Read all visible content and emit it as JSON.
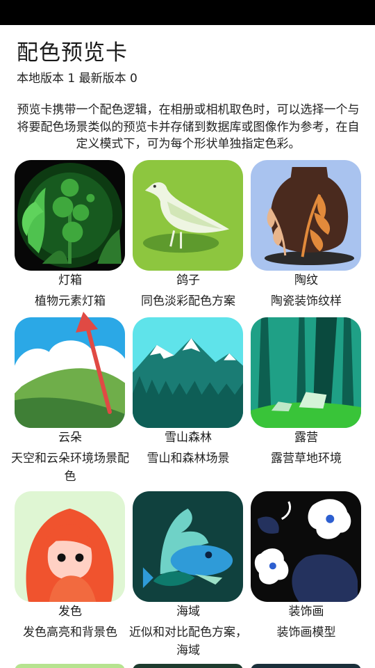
{
  "header": {
    "title": "配色预览卡",
    "version_line": "本地版本 1 最新版本 0",
    "description": "预览卡携带一个配色逻辑，在相册或相机取色时，可以选择一个与将要配色场景类似的预览卡并存储到数据库或图像作为参考，在自定义模式下，可为每个形状单独指定色彩。"
  },
  "cards": [
    {
      "name": "灯箱",
      "desc": "植物元素灯箱",
      "icon": "lightbox-plant-icon"
    },
    {
      "name": "鸽子",
      "desc": "同色淡彩配色方案",
      "icon": "dove-icon"
    },
    {
      "name": "陶纹",
      "desc": "陶瓷装饰纹样",
      "icon": "pottery-icon"
    },
    {
      "name": "云朵",
      "desc": "天空和云朵环境场景配色",
      "icon": "cloud-icon"
    },
    {
      "name": "雪山森林",
      "desc": "雪山和森林场景",
      "icon": "snow-mountain-icon"
    },
    {
      "name": "露营",
      "desc": "露营草地环境",
      "icon": "camping-icon"
    },
    {
      "name": "发色",
      "desc": "发色高亮和背景色",
      "icon": "hair-portrait-icon"
    },
    {
      "name": "海域",
      "desc": "近似和对比配色方案，海域",
      "icon": "sea-fish-icon"
    },
    {
      "name": "装饰画",
      "desc": "装饰画模型",
      "icon": "decorative-flower-icon"
    }
  ],
  "colors": {
    "annotation_arrow": "#e04a44"
  }
}
